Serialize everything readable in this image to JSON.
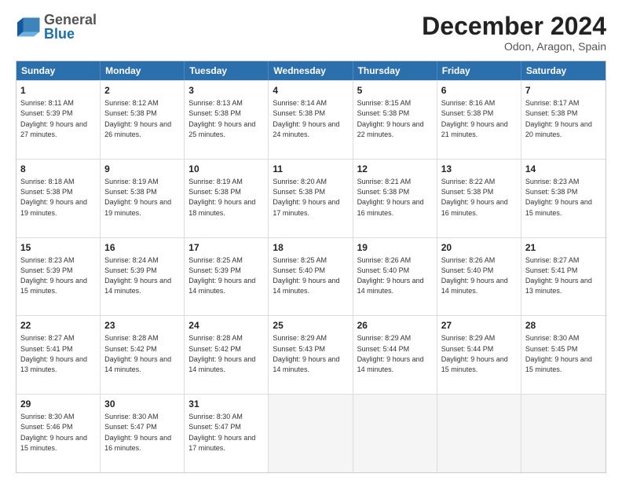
{
  "logo": {
    "general": "General",
    "blue": "Blue"
  },
  "header": {
    "title": "December 2024",
    "subtitle": "Odon, Aragon, Spain"
  },
  "weekdays": [
    "Sunday",
    "Monday",
    "Tuesday",
    "Wednesday",
    "Thursday",
    "Friday",
    "Saturday"
  ],
  "weeks": [
    [
      {
        "day": "1",
        "sunrise": "Sunrise: 8:11 AM",
        "sunset": "Sunset: 5:39 PM",
        "daylight": "Daylight: 9 hours and 27 minutes."
      },
      {
        "day": "2",
        "sunrise": "Sunrise: 8:12 AM",
        "sunset": "Sunset: 5:38 PM",
        "daylight": "Daylight: 9 hours and 26 minutes."
      },
      {
        "day": "3",
        "sunrise": "Sunrise: 8:13 AM",
        "sunset": "Sunset: 5:38 PM",
        "daylight": "Daylight: 9 hours and 25 minutes."
      },
      {
        "day": "4",
        "sunrise": "Sunrise: 8:14 AM",
        "sunset": "Sunset: 5:38 PM",
        "daylight": "Daylight: 9 hours and 24 minutes."
      },
      {
        "day": "5",
        "sunrise": "Sunrise: 8:15 AM",
        "sunset": "Sunset: 5:38 PM",
        "daylight": "Daylight: 9 hours and 22 minutes."
      },
      {
        "day": "6",
        "sunrise": "Sunrise: 8:16 AM",
        "sunset": "Sunset: 5:38 PM",
        "daylight": "Daylight: 9 hours and 21 minutes."
      },
      {
        "day": "7",
        "sunrise": "Sunrise: 8:17 AM",
        "sunset": "Sunset: 5:38 PM",
        "daylight": "Daylight: 9 hours and 20 minutes."
      }
    ],
    [
      {
        "day": "8",
        "sunrise": "Sunrise: 8:18 AM",
        "sunset": "Sunset: 5:38 PM",
        "daylight": "Daylight: 9 hours and 19 minutes."
      },
      {
        "day": "9",
        "sunrise": "Sunrise: 8:19 AM",
        "sunset": "Sunset: 5:38 PM",
        "daylight": "Daylight: 9 hours and 19 minutes."
      },
      {
        "day": "10",
        "sunrise": "Sunrise: 8:19 AM",
        "sunset": "Sunset: 5:38 PM",
        "daylight": "Daylight: 9 hours and 18 minutes."
      },
      {
        "day": "11",
        "sunrise": "Sunrise: 8:20 AM",
        "sunset": "Sunset: 5:38 PM",
        "daylight": "Daylight: 9 hours and 17 minutes."
      },
      {
        "day": "12",
        "sunrise": "Sunrise: 8:21 AM",
        "sunset": "Sunset: 5:38 PM",
        "daylight": "Daylight: 9 hours and 16 minutes."
      },
      {
        "day": "13",
        "sunrise": "Sunrise: 8:22 AM",
        "sunset": "Sunset: 5:38 PM",
        "daylight": "Daylight: 9 hours and 16 minutes."
      },
      {
        "day": "14",
        "sunrise": "Sunrise: 8:23 AM",
        "sunset": "Sunset: 5:38 PM",
        "daylight": "Daylight: 9 hours and 15 minutes."
      }
    ],
    [
      {
        "day": "15",
        "sunrise": "Sunrise: 8:23 AM",
        "sunset": "Sunset: 5:39 PM",
        "daylight": "Daylight: 9 hours and 15 minutes."
      },
      {
        "day": "16",
        "sunrise": "Sunrise: 8:24 AM",
        "sunset": "Sunset: 5:39 PM",
        "daylight": "Daylight: 9 hours and 14 minutes."
      },
      {
        "day": "17",
        "sunrise": "Sunrise: 8:25 AM",
        "sunset": "Sunset: 5:39 PM",
        "daylight": "Daylight: 9 hours and 14 minutes."
      },
      {
        "day": "18",
        "sunrise": "Sunrise: 8:25 AM",
        "sunset": "Sunset: 5:40 PM",
        "daylight": "Daylight: 9 hours and 14 minutes."
      },
      {
        "day": "19",
        "sunrise": "Sunrise: 8:26 AM",
        "sunset": "Sunset: 5:40 PM",
        "daylight": "Daylight: 9 hours and 14 minutes."
      },
      {
        "day": "20",
        "sunrise": "Sunrise: 8:26 AM",
        "sunset": "Sunset: 5:40 PM",
        "daylight": "Daylight: 9 hours and 14 minutes."
      },
      {
        "day": "21",
        "sunrise": "Sunrise: 8:27 AM",
        "sunset": "Sunset: 5:41 PM",
        "daylight": "Daylight: 9 hours and 13 minutes."
      }
    ],
    [
      {
        "day": "22",
        "sunrise": "Sunrise: 8:27 AM",
        "sunset": "Sunset: 5:41 PM",
        "daylight": "Daylight: 9 hours and 13 minutes."
      },
      {
        "day": "23",
        "sunrise": "Sunrise: 8:28 AM",
        "sunset": "Sunset: 5:42 PM",
        "daylight": "Daylight: 9 hours and 14 minutes."
      },
      {
        "day": "24",
        "sunrise": "Sunrise: 8:28 AM",
        "sunset": "Sunset: 5:42 PM",
        "daylight": "Daylight: 9 hours and 14 minutes."
      },
      {
        "day": "25",
        "sunrise": "Sunrise: 8:29 AM",
        "sunset": "Sunset: 5:43 PM",
        "daylight": "Daylight: 9 hours and 14 minutes."
      },
      {
        "day": "26",
        "sunrise": "Sunrise: 8:29 AM",
        "sunset": "Sunset: 5:44 PM",
        "daylight": "Daylight: 9 hours and 14 minutes."
      },
      {
        "day": "27",
        "sunrise": "Sunrise: 8:29 AM",
        "sunset": "Sunset: 5:44 PM",
        "daylight": "Daylight: 9 hours and 15 minutes."
      },
      {
        "day": "28",
        "sunrise": "Sunrise: 8:30 AM",
        "sunset": "Sunset: 5:45 PM",
        "daylight": "Daylight: 9 hours and 15 minutes."
      }
    ],
    [
      {
        "day": "29",
        "sunrise": "Sunrise: 8:30 AM",
        "sunset": "Sunset: 5:46 PM",
        "daylight": "Daylight: 9 hours and 15 minutes."
      },
      {
        "day": "30",
        "sunrise": "Sunrise: 8:30 AM",
        "sunset": "Sunset: 5:47 PM",
        "daylight": "Daylight: 9 hours and 16 minutes."
      },
      {
        "day": "31",
        "sunrise": "Sunrise: 8:30 AM",
        "sunset": "Sunset: 5:47 PM",
        "daylight": "Daylight: 9 hours and 17 minutes."
      },
      null,
      null,
      null,
      null
    ]
  ]
}
